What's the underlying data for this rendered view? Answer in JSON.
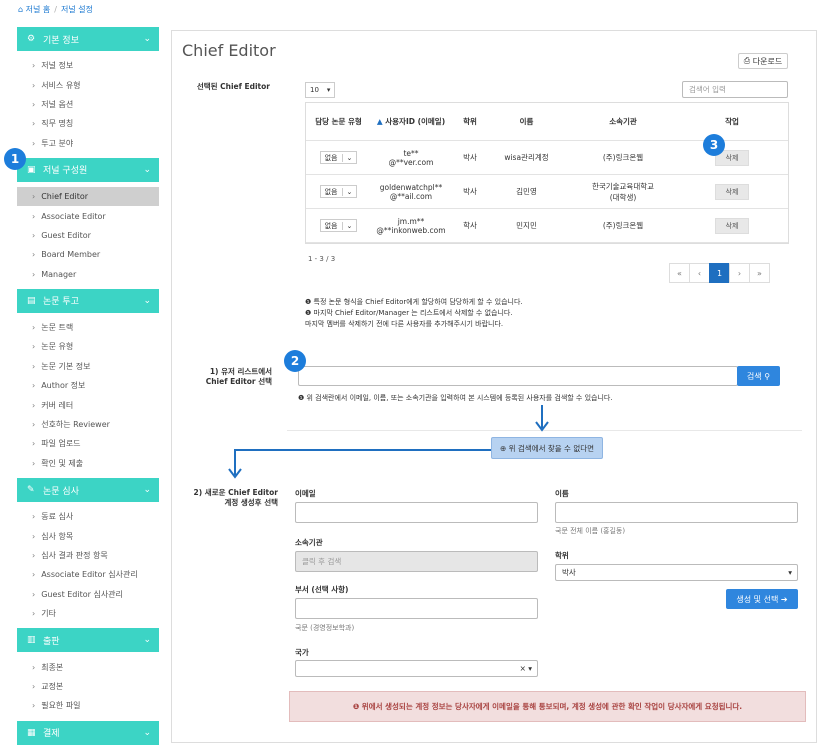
{
  "breadcrumb": {
    "home": "저널 홈",
    "current": "저널 설정"
  },
  "sidebar": [
    {
      "title": "기본 정보",
      "icon": "⚙",
      "items": [
        "저널 정보",
        "서비스 유형",
        "저널 옵션",
        "직무 명칭",
        "투고 분야"
      ]
    },
    {
      "title": "저널 구성원",
      "icon": "▣",
      "items": [
        "Chief Editor",
        "Associate Editor",
        "Guest Editor",
        "Board Member",
        "Manager"
      ]
    },
    {
      "title": "논문 투고",
      "icon": "▤",
      "items": [
        "논문 트랙",
        "논문 유형",
        "논문 기본 정보",
        "Author 정보",
        "커버 레터",
        "선호하는 Reviewer",
        "파일 업로드",
        "확인 및 제출"
      ]
    },
    {
      "title": "논문 심사",
      "icon": "✎",
      "items": [
        "동료 심사",
        "심사 항목",
        "심사 결과 판정 항목",
        "Associate Editor 심사관리",
        "Guest Editor 심사관리",
        "기타"
      ]
    },
    {
      "title": "출판",
      "icon": "▥",
      "items": [
        "최종본",
        "교정본",
        "필요한 파일"
      ]
    },
    {
      "title": "결제",
      "icon": "▦",
      "items": []
    }
  ],
  "page": {
    "title": "Chief Editor",
    "download": "다운로드"
  },
  "selected": {
    "label": "선택된 Chief Editor",
    "page_size": "10",
    "search_placeholder": "검색어 입력",
    "headers": [
      "담당 논문 유형",
      "사용자ID (이메일)",
      "학위",
      "이름",
      "소속기관",
      "작업"
    ],
    "rows": [
      {
        "type": "없음",
        "email1": "te**",
        "email2": "@**ver.com",
        "degree": "박사",
        "name": "wisa관리계정",
        "org1": "(주)링크온웹",
        "org2": "",
        "action": "삭제"
      },
      {
        "type": "없음",
        "email1": "goldenwatchpl**",
        "email2": "@**ail.com",
        "degree": "박사",
        "name": "김민영",
        "org1": "한국기술교육대학교",
        "org2": "(대학생)",
        "action": "삭제"
      },
      {
        "type": "없음",
        "email1": "jm.m**",
        "email2": "@**inkonweb.com",
        "degree": "학사",
        "name": "민지민",
        "org1": "(주)링크온웹",
        "org2": "",
        "action": "삭제"
      }
    ],
    "count": "1 - 3 / 3",
    "pages": [
      "«",
      "‹",
      "1",
      "›",
      "»"
    ]
  },
  "notes": [
    "❶ 특정 논문 형식을 Chief Editor에게 할당하여 담당하게 할 수 있습니다.",
    "❶ 마지막 Chief Editor/Manager 는 리스트에서 삭제할 수 없습니다.",
    "마지막 멤버를 삭제하기 전에 다른 사용자를 추가해주시기 바랍니다."
  ],
  "step1": {
    "label1": "1) 유저 리스트에서",
    "label2": "Chief Editor 선택",
    "search_btn": "검색",
    "hint": "❶ 위 검색란에서 이메일, 이름, 또는 소속기관을 입력하여 본 시스템에 등록된 사용자를 검색할 수 있습니다.",
    "notfound": "⊕ 위 검색에서 찾을 수 없다면"
  },
  "step2": {
    "label1": "2) 새로운 Chief Editor",
    "label2": "계정 생성후 선택",
    "email_label": "이메일",
    "name_label": "이름",
    "name_hint": "국문 전체 이름 (홍길동)",
    "org_label": "소속기관",
    "org_placeholder": "클릭 후 검색",
    "degree_label": "학위",
    "degree_value": "박사",
    "dept_label": "부서 (선택 사항)",
    "dept_hint": "국문 (경영정보학과)",
    "country_label": "국가",
    "create_btn": "생성 및 선택"
  },
  "alert": "❶ 위에서 생성되는 계정 정보는 당사자에게 이메일을 통해 통보되며, 계정 생성에 관한 확인 작업이 당사자에게 요청됩니다.",
  "badges": [
    "1",
    "2",
    "3"
  ]
}
